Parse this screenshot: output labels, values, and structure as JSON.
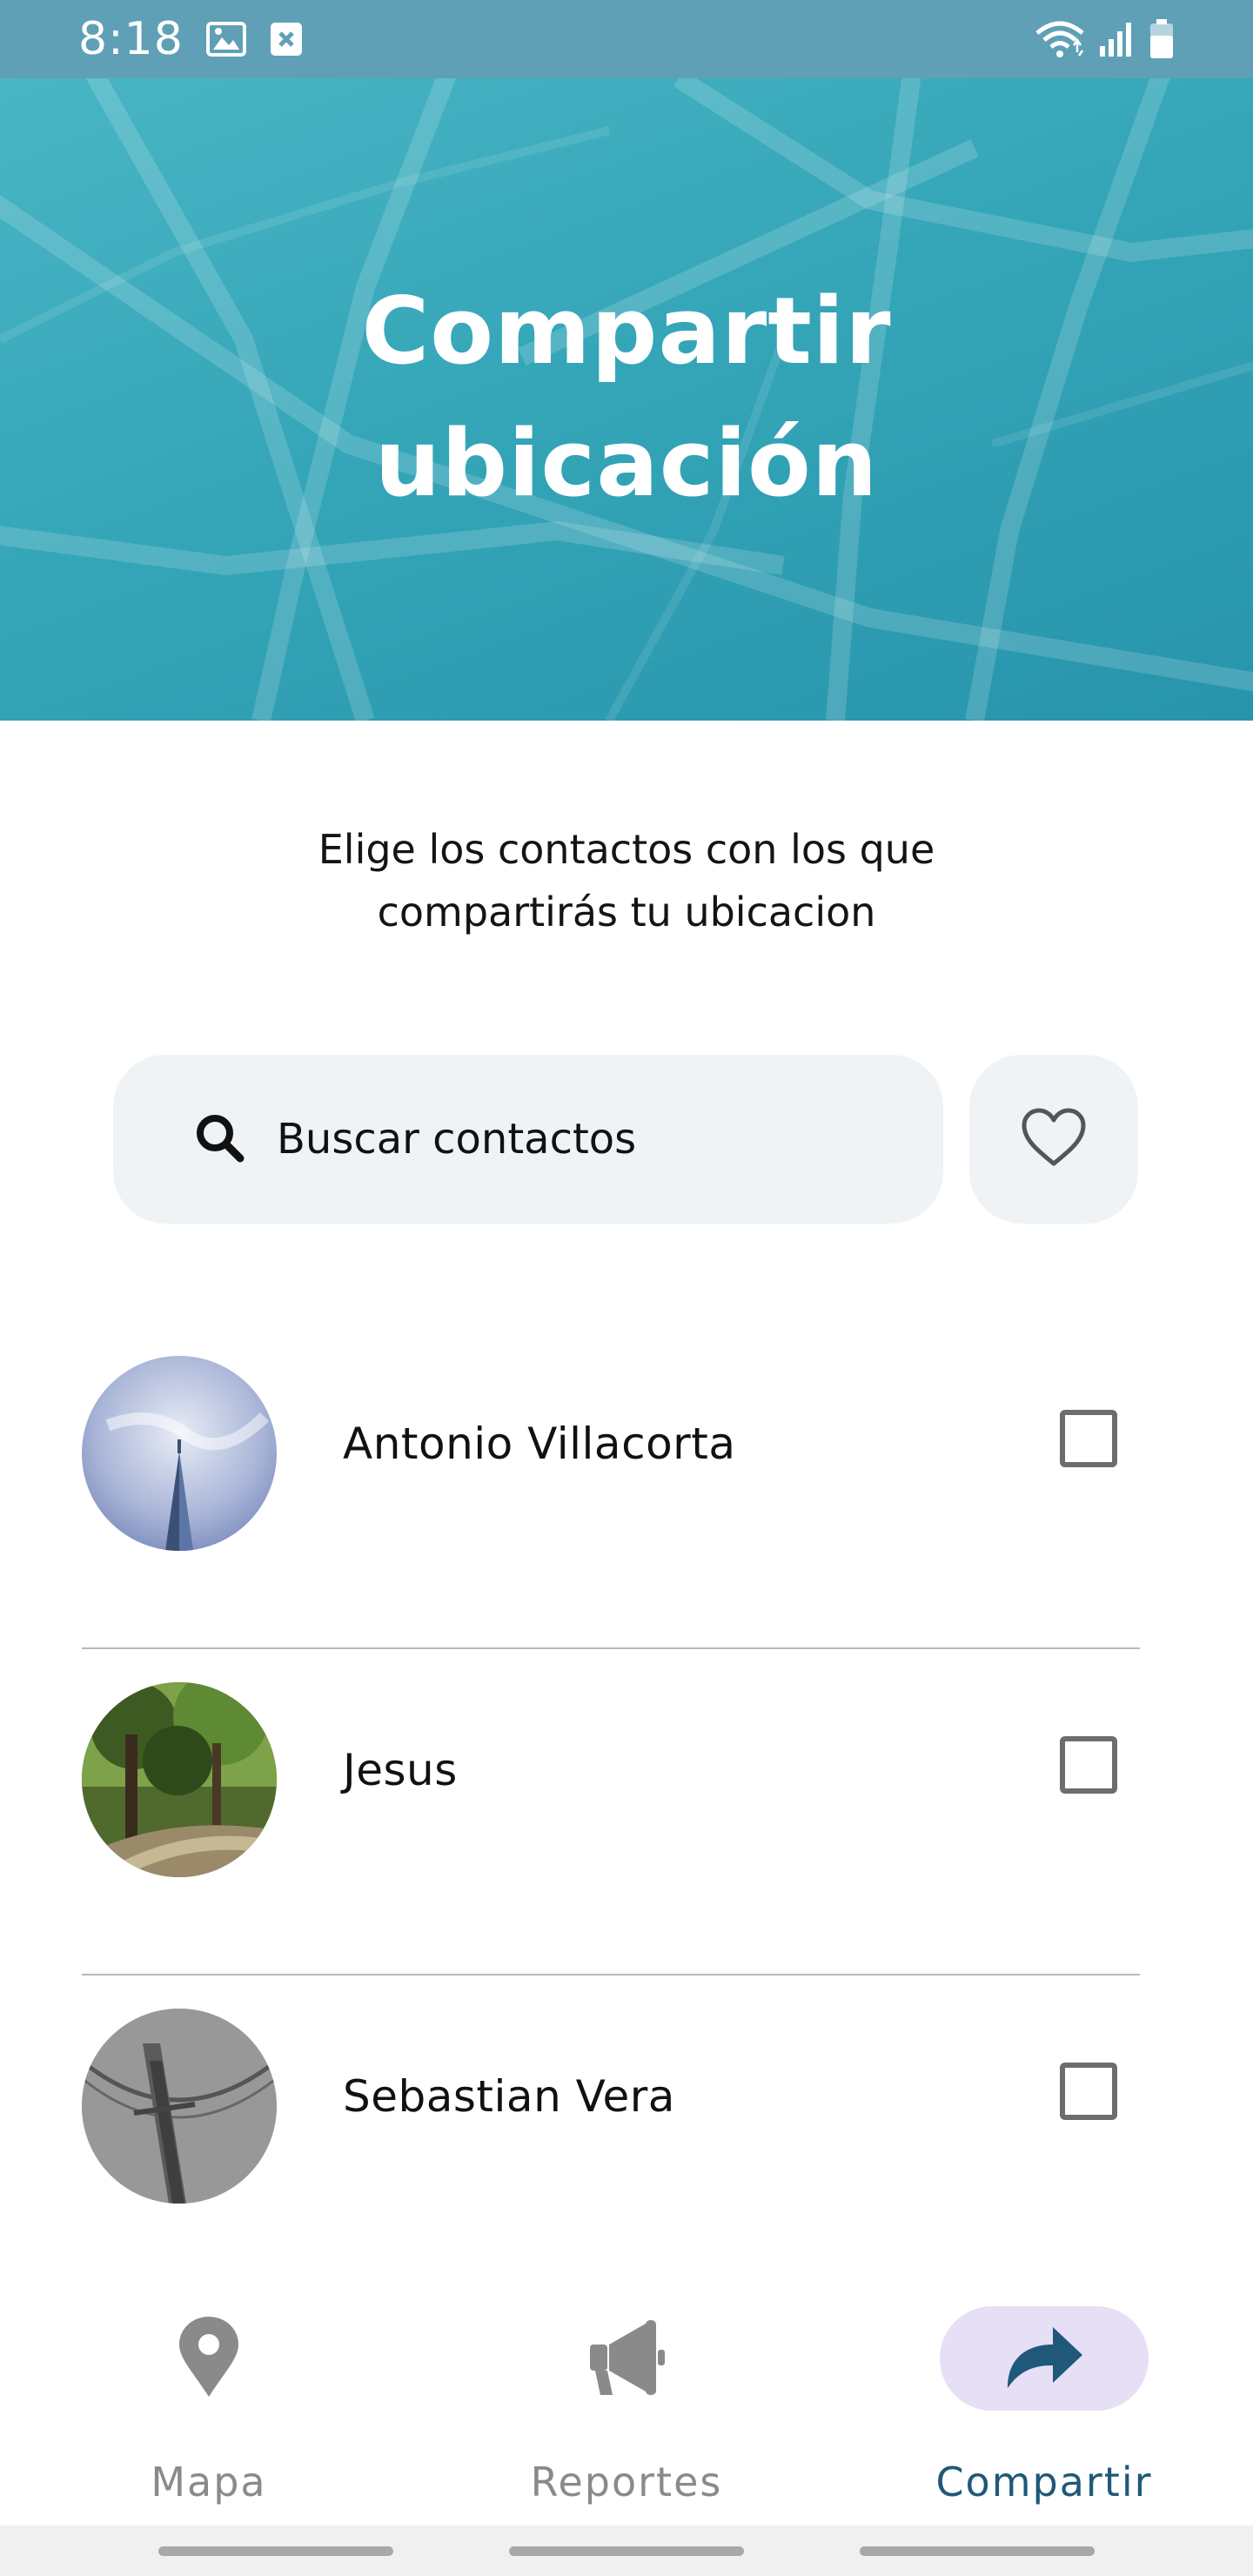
{
  "status_bar": {
    "time": "8:18",
    "icons": [
      "image-icon",
      "close-box-icon",
      "wifi-icon",
      "signal-icon",
      "battery-icon"
    ]
  },
  "header": {
    "title_line1": "Compartir",
    "title_line2": "ubicación"
  },
  "instruction": {
    "line1": "Elige los contactos con los que",
    "line2": "compartirás tu ubicacion"
  },
  "search": {
    "placeholder": "Buscar contactos",
    "icon": "search-icon"
  },
  "favorites_button": {
    "icon": "heart-icon"
  },
  "contacts": [
    {
      "name": "Antonio Villacorta",
      "avatar": "skyscraper-photo",
      "checked": false
    },
    {
      "name": "Jesus",
      "avatar": "forest-photo",
      "checked": false
    },
    {
      "name": "Sebastian Vera",
      "avatar": "bridge-photo",
      "checked": false
    }
  ],
  "bottom_nav": {
    "items": [
      {
        "label": "Mapa",
        "icon": "map-pin-icon",
        "active": false
      },
      {
        "label": "Reportes",
        "icon": "megaphone-icon",
        "active": false
      },
      {
        "label": "Compartir",
        "icon": "share-arrow-icon",
        "active": true
      }
    ]
  },
  "colors": {
    "status_bar": "#5fa0b7",
    "header": "#35a6b8",
    "active_nav_pill": "#e6dff6",
    "active_nav_text": "#1f5878",
    "inactive_nav": "#8a8a8a"
  }
}
